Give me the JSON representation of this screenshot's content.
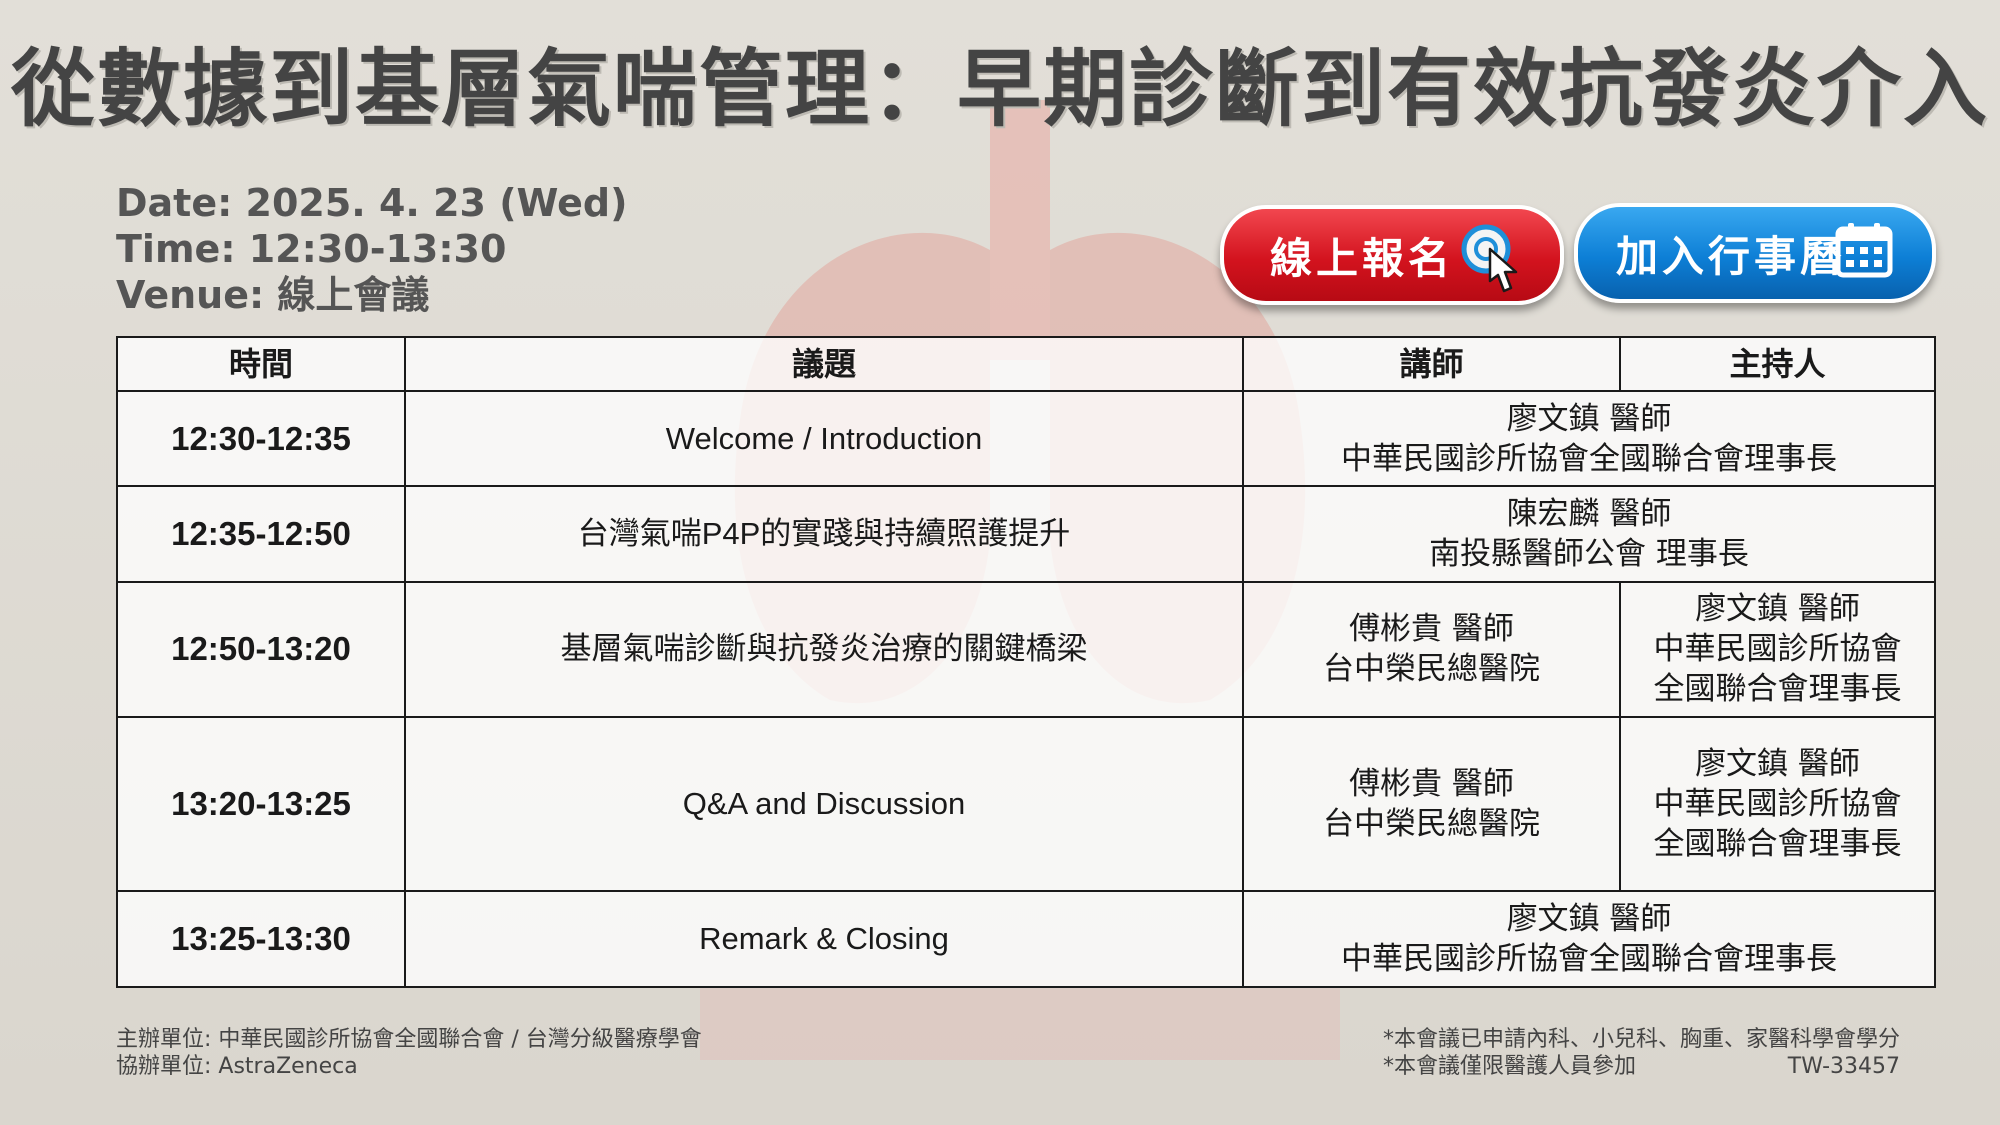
{
  "title": "從數據到基層氣喘管理：早期診斷到有效抗發炎介入",
  "event_info": {
    "date": "Date: 2025. 4. 23 (Wed)",
    "time": "Time: 12:30-13:30",
    "venue": "Venue: 線上會議"
  },
  "buttons": {
    "register": "線上報名",
    "register_icon": "pointer-click-icon",
    "calendar": "加入行事曆",
    "calendar_icon": "calendar-icon"
  },
  "table": {
    "headers": [
      "時間",
      "議題",
      "講師",
      "主持人"
    ],
    "rows": [
      {
        "time": "12:30-12:35",
        "topic": "Welcome / Introduction",
        "speaker_name": "廖文鎮 醫師",
        "speaker_title": "中華民國診所協會全國聯合會理事長"
      },
      {
        "time": "12:35-12:50",
        "topic": "台灣氣喘P4P的實踐與持續照護提升",
        "speaker_name": "陳宏麟 醫師",
        "speaker_title": "南投縣醫師公會 理事長"
      },
      {
        "time": "12:50-13:20",
        "topic": "基層氣喘診斷與抗發炎治療的關鍵橋梁",
        "speaker_name": "傅彬貴 醫師",
        "speaker_title": "台中榮民總醫院",
        "moderator_name": "廖文鎮 醫師",
        "moderator_title_1": "中華民國診所協會",
        "moderator_title_2": "全國聯合會理事長"
      },
      {
        "time": "13:20-13:25",
        "topic": "Q&A and Discussion",
        "speaker_name": "傅彬貴 醫師",
        "speaker_title": "台中榮民總醫院",
        "moderator_name": "廖文鎮 醫師",
        "moderator_title_1": "中華民國診所協會",
        "moderator_title_2": "全國聯合會理事長"
      },
      {
        "time": "13:25-13:30",
        "topic": "Remark & Closing",
        "speaker_name": "廖文鎮 醫師",
        "speaker_title": "中華民國診所協會全國聯合會理事長"
      }
    ]
  },
  "footer": {
    "organizer": "主辦單位: 中華民國診所協會全國聯合會 / 台灣分級醫療學會",
    "co_organizer": "協辦單位: AstraZeneca",
    "note_credits": "*本會議已申請內科、小兒科、胸重、家醫科學會學分",
    "note_attendance": "*本會議僅限醫護人員參加",
    "code": "TW-33457"
  },
  "colors": {
    "register_button": "#d3131e",
    "calendar_button": "#0d7fd6",
    "title_text": "#444444"
  }
}
